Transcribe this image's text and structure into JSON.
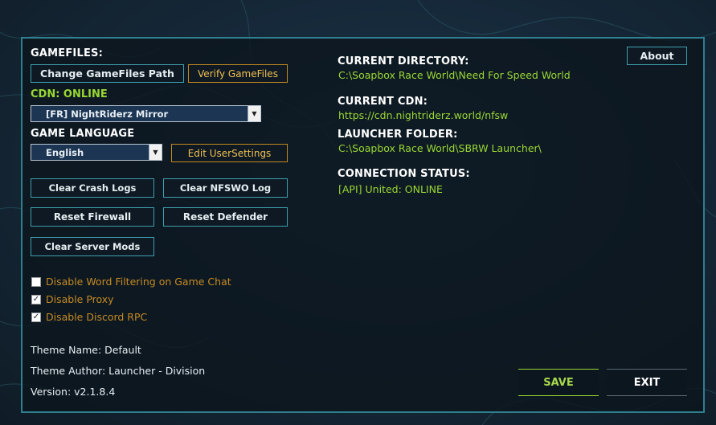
{
  "gamefiles": {
    "header": "GAMEFILES:",
    "change_path_label": "Change GameFiles Path",
    "verify_label": "Verify GameFiles"
  },
  "cdn": {
    "status_label": "CDN: ONLINE",
    "selected": "[FR] NightRiderz Mirror"
  },
  "language": {
    "header": "GAME LANGUAGE",
    "selected": "English",
    "edit_settings_label": "Edit UserSettings"
  },
  "tools": {
    "clear_crash_logs": "Clear Crash Logs",
    "clear_nfswo_log": "Clear NFSWO Log",
    "reset_firewall": "Reset Firewall",
    "reset_defender": "Reset Defender",
    "clear_server_mods": "Clear Server Mods"
  },
  "options": {
    "disable_word_filtering": {
      "label": "Disable Word Filtering on Game Chat",
      "checked": false
    },
    "disable_proxy": {
      "label": "Disable Proxy",
      "checked": true
    },
    "disable_discord_rpc": {
      "label": "Disable Discord RPC",
      "checked": true
    }
  },
  "theme": {
    "name_text": "Theme Name: Default",
    "author_text": "Theme Author: Launcher - Division",
    "version_text": "Version: v2.1.8.4"
  },
  "info": {
    "current_directory_header": "CURRENT DIRECTORY:",
    "current_directory_value": "C:\\Soapbox Race World\\Need For Speed World",
    "current_cdn_header": "CURRENT CDN:",
    "current_cdn_value": "https://cdn.nightriderz.world/nfsw",
    "launcher_folder_header": "LAUNCHER FOLDER:",
    "launcher_folder_value": "C:\\Soapbox Race World\\SBRW Launcher\\",
    "connection_status_header": "CONNECTION STATUS:",
    "connection_status_value": "[API] United: ONLINE"
  },
  "about_label": "About",
  "save_label": "SAVE",
  "exit_label": "EXIT",
  "colors": {
    "accent_teal": "#3da0ae",
    "accent_gold": "#c28a1f",
    "accent_green": "#9ad833",
    "panel_border": "#2f7f8f"
  }
}
